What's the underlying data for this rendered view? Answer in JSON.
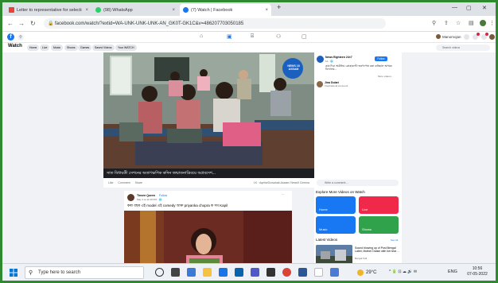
{
  "tabs": [
    {
      "title": "Letter to representative for selecti",
      "favicon_color": "#ea4335"
    },
    {
      "title": "(98) WhatsApp",
      "favicon_color": "#25d366"
    },
    {
      "title": "(7) Watch | Facebook",
      "favicon_color": "#1877f2"
    }
  ],
  "new_tab": "+",
  "address": {
    "url": "facebook.com/watch/?extid=WA-UNK-UNK-UNK-AN_GK0T-GK1C&v=486207703050185"
  },
  "fb": {
    "logo": "f",
    "user_name": "Manomojan",
    "watch_title": "Watch",
    "pills": [
      "Home",
      "Live",
      "Music",
      "Shows",
      "Games",
      "Saved Videos",
      "Your WATCH"
    ],
    "search_placeholder": "Search videos"
  },
  "video": {
    "caption": "সাত বিধায়কী সেশনের অতাৎক্ষণিক কদিন জন্মাতনাদ্রিবয়ে অপ্রবদেশ...",
    "actions": [
      "Like",
      "Comment",
      "Share"
    ],
    "views": "1K · Aqelia/Guwahati-Assam/ News9 Cinema",
    "logo_text": "NEWS 18 ASSAM"
  },
  "right": {
    "page_name": "News Eighteen 24×7",
    "page_meta": "1d · 🌐",
    "follow": "Follow",
    "desc": "কাৰ দিবা অকঁলিয় কোৰাৰণ্টো ভৰণপোষ কৰা কৰিছাল অসমৰ বিদ্যালয়...",
    "see_more": "More videos ↓",
    "commenter": "Jina Dulari",
    "commenter_meta": "Inspirational comment",
    "comment_placeholder": "Write a comment…",
    "explore": "Explore More Videos on Watch",
    "tiles": [
      {
        "label": "Home",
        "color": "#1877f2"
      },
      {
        "label": "Live",
        "color": "#f02849"
      },
      {
        "label": "Music",
        "color": "#1877f2"
      },
      {
        "label": "Shows",
        "color": "#31a24c"
      }
    ],
    "latest": "Latest Videos",
    "see_all": "See All",
    "latest_title": "Sound blowing up of Post Bengal Label, Mother Daisie with her tear…",
    "latest_meta": "Bengal Kali"
  },
  "post2": {
    "author": "Tinsen Queen",
    "follow": "Follow",
    "meta": "May 4 at 11:30 PM · 🌐",
    "text": "কৰা বছৰ এই model এই comedy আৰু priyanka chopra ক সম Kapil"
  },
  "taskbar": {
    "search": "Type here to search",
    "weather": "29°C",
    "lang": "ENG",
    "time": "10:56",
    "date": "07-05-2022",
    "tray": "^ 🔋 ⊡ ☁ 🔊 ✉"
  }
}
